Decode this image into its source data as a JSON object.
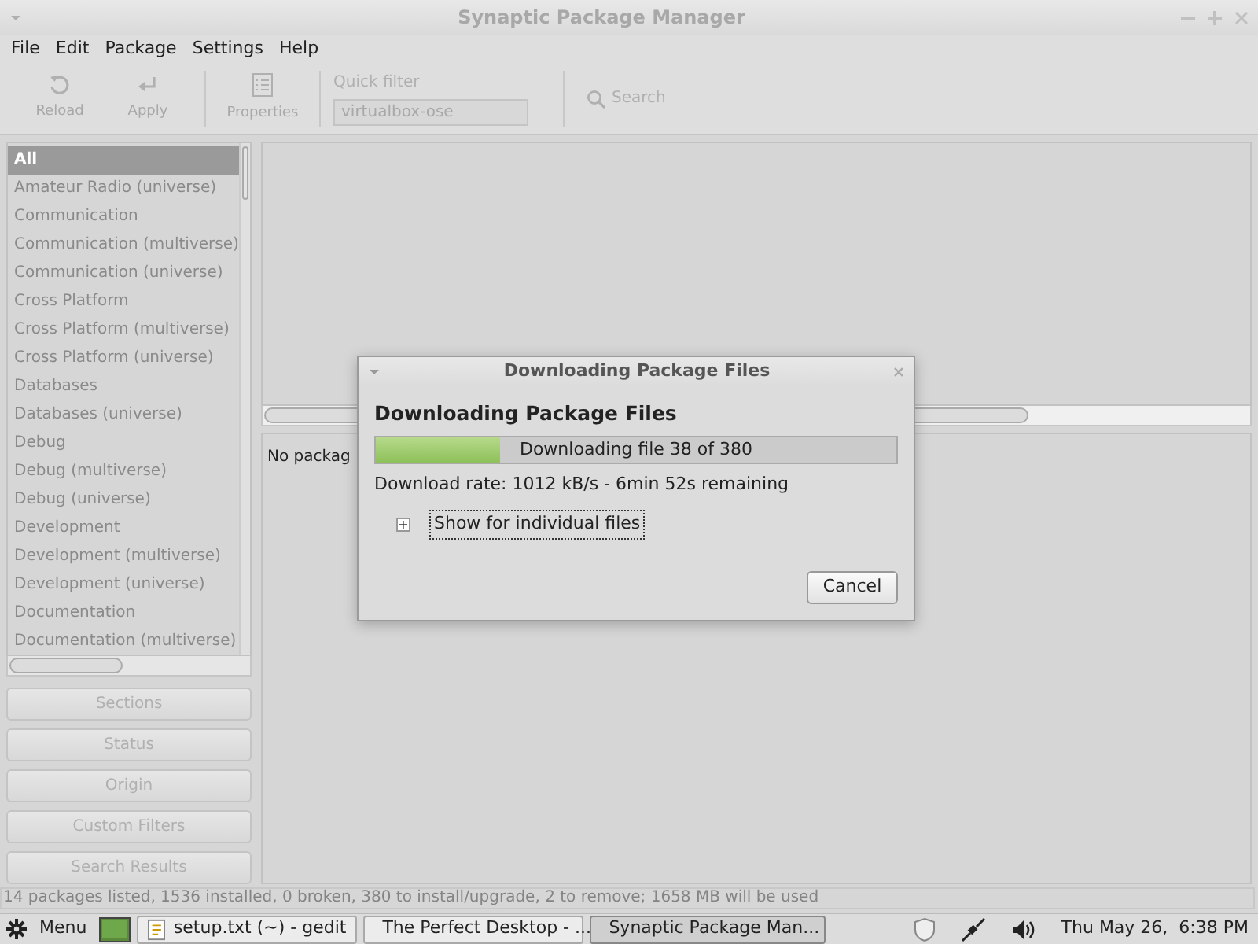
{
  "window": {
    "title": "Synaptic Package Manager"
  },
  "menu": [
    "File",
    "Edit",
    "Package",
    "Settings",
    "Help"
  ],
  "toolbar": {
    "buttons": [
      {
        "label": "Reload",
        "kind": "reload",
        "disabled": true
      },
      {
        "label": "Apply",
        "kind": "apply",
        "disabled": true
      },
      {
        "label": "Properties",
        "kind": "properties",
        "disabled": true
      }
    ],
    "quick_filter": {
      "label": "Quick filter",
      "value": "virtualbox-ose"
    },
    "search": {
      "label": "Search"
    }
  },
  "sections": [
    {
      "label": "All",
      "selected": true
    },
    {
      "label": "Amateur Radio (universe)",
      "selected": false
    },
    {
      "label": "Communication",
      "selected": false
    },
    {
      "label": "Communication (multiverse)",
      "selected": false
    },
    {
      "label": "Communication (universe)",
      "selected": false
    },
    {
      "label": "Cross Platform",
      "selected": false
    },
    {
      "label": "Cross Platform (multiverse)",
      "selected": false
    },
    {
      "label": "Cross Platform (universe)",
      "selected": false
    },
    {
      "label": "Databases",
      "selected": false
    },
    {
      "label": "Databases (universe)",
      "selected": false
    },
    {
      "label": "Debug",
      "selected": false
    },
    {
      "label": "Debug (multiverse)",
      "selected": false
    },
    {
      "label": "Debug (universe)",
      "selected": false
    },
    {
      "label": "Development",
      "selected": false
    },
    {
      "label": "Development (multiverse)",
      "selected": false
    },
    {
      "label": "Development (universe)",
      "selected": false
    },
    {
      "label": "Documentation",
      "selected": false
    },
    {
      "label": "Documentation (multiverse)",
      "selected": false
    }
  ],
  "filter_buttons": [
    "Sections",
    "Status",
    "Origin",
    "Custom Filters",
    "Search Results"
  ],
  "details": {
    "text": "No packag"
  },
  "status_bar": "14 packages listed, 1536 installed, 0 broken, 380 to install/upgrade, 2 to remove; 1658 MB will be used",
  "dialog": {
    "title": "Downloading Package Files",
    "heading": "Downloading Package Files",
    "progress": {
      "level": 0.24,
      "text": "Downloading file 38 of 380"
    },
    "rate": "Download rate: 1012 kB/s - 6min 52s remaining",
    "expander": {
      "label": "Show for individual files",
      "expanded": false,
      "sign": "+"
    },
    "buttons": [
      "Cancel"
    ]
  },
  "taskbar": {
    "menu": "Menu",
    "tasks": [
      {
        "label": "setup.txt (~) - gedit",
        "kind": "editor",
        "selected": false
      },
      {
        "label": "The Perfect Desktop - ...",
        "kind": "browser",
        "selected": false
      },
      {
        "label": "Synaptic Package Man...",
        "kind": "package",
        "selected": true
      }
    ],
    "clock": "Thu May 26,  6:38 PM"
  }
}
